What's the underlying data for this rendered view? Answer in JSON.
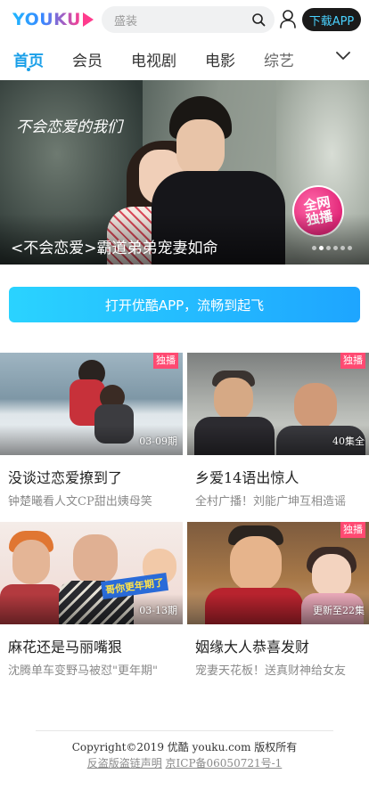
{
  "header": {
    "logo_text": "YOUKU",
    "search_placeholder": "盛装",
    "download_label": "下载APP"
  },
  "tabs": [
    {
      "label": "首页",
      "active": true
    },
    {
      "label": "会员",
      "active": false
    },
    {
      "label": "电视剧",
      "active": false
    },
    {
      "label": "电影",
      "active": false
    },
    {
      "label": "综艺",
      "active": false
    }
  ],
  "banner": {
    "art_title": "不会恋爱的我们",
    "badge_line1": "全网",
    "badge_line2": "独播",
    "caption": "<不会恋爱>霸道弟弟宠妻如命",
    "slide_count": 6,
    "active_slide": 1
  },
  "cta": {
    "label": "打开优酷APP，流畅到起飞"
  },
  "cards": [
    {
      "title": "没谈过恋爱撩到了",
      "subtitle": "钟楚曦看人文CP甜出姨母笑",
      "meta": "03-09期",
      "exclusive": "独播"
    },
    {
      "title": "乡爱14语出惊人",
      "subtitle": "全村广播！刘能广坤互相造谣",
      "meta": "40集全",
      "exclusive": "独播"
    },
    {
      "title": "麻花还是马丽嘴狠",
      "subtitle": "沈腾单车变野马被怼\"更年期\"",
      "meta": "03-13期",
      "exclusive": "",
      "caption_art": "哥你更年期了"
    },
    {
      "title": "姻缘大人恭喜发财",
      "subtitle": "宠妻天花板！送真财神给女友",
      "meta": "更新至22集",
      "exclusive": "独播"
    }
  ],
  "footer": {
    "copyright": "Copyright©2019 优酷 youku.com 版权所有",
    "link1": "反盗版盗链声明",
    "link2": "京ICP备06050721号-1"
  },
  "colors": {
    "accent": "#1a9fe8",
    "exclusive_badge": "#ff4a72",
    "download_text": "#49d2ff"
  }
}
